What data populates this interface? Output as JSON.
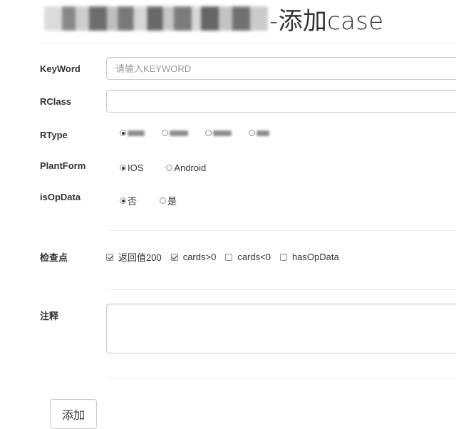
{
  "header": {
    "title_suffix": "-添加case"
  },
  "form": {
    "keyword": {
      "label": "KeyWord",
      "value": "",
      "placeholder": "请输入KEYWORD"
    },
    "rclass": {
      "label": "RClass",
      "value": "",
      "placeholder": ""
    },
    "rtype": {
      "label": "RType"
    },
    "plantform": {
      "label": "PlantForm",
      "options": [
        {
          "label": "IOS",
          "checked": true
        },
        {
          "label": "Android",
          "checked": false
        }
      ]
    },
    "isopdata": {
      "label": "isOpData",
      "options": [
        {
          "label": "否",
          "checked": true
        },
        {
          "label": "是",
          "checked": false
        }
      ]
    },
    "checkpoints": {
      "label": "检查点",
      "options": [
        {
          "label": "返回值200",
          "checked": true
        },
        {
          "label": "cards>0",
          "checked": true
        },
        {
          "label": "cards<0",
          "checked": false
        },
        {
          "label": "hasOpData",
          "checked": false
        }
      ]
    },
    "comment": {
      "label": "注释",
      "value": ""
    }
  },
  "actions": {
    "add_label": "添加"
  }
}
